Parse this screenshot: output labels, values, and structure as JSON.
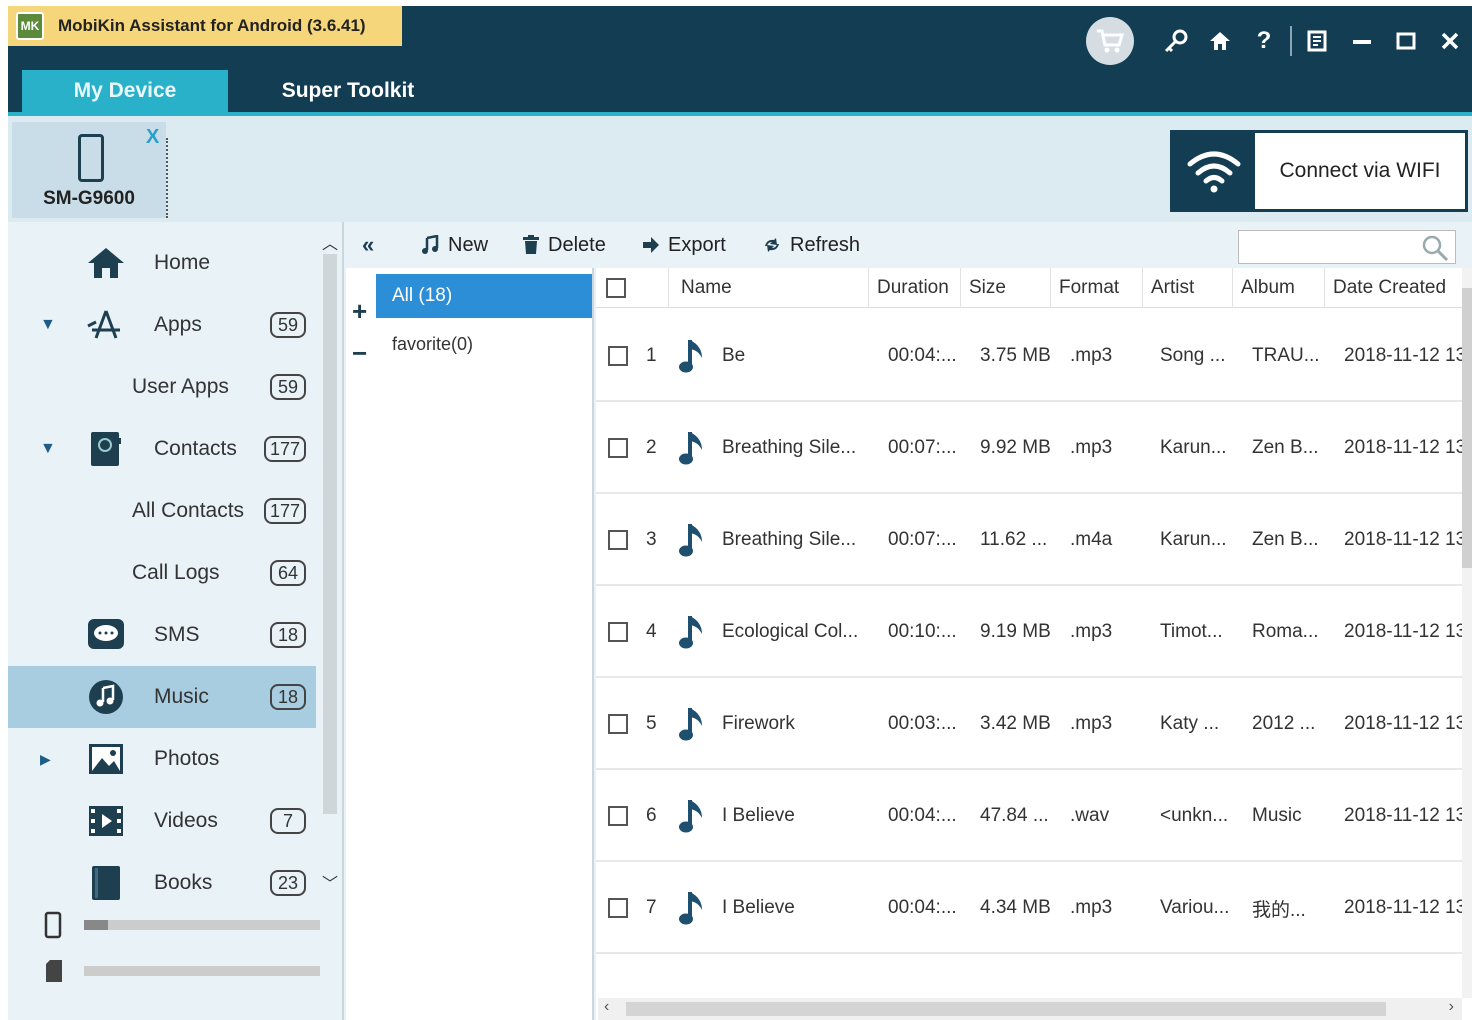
{
  "app": {
    "title": "MobiKin Assistant for Android (3.6.41)",
    "logo_text": "MK",
    "colors": {
      "titlebar": "#133d52",
      "accent": "#29b1c9",
      "title_chip": "#f5d67a",
      "selected_group": "#2b8ed6",
      "selected_nav": "#a8cde0"
    }
  },
  "window_icons": [
    "cart-icon",
    "key-icon",
    "home-icon",
    "help-icon",
    "feedback-icon",
    "minimize-icon",
    "maximize-icon",
    "close-icon"
  ],
  "tabs": [
    {
      "label": "My Device",
      "active": true
    },
    {
      "label": "Super Toolkit",
      "active": false
    }
  ],
  "device": {
    "name": "SM-G9600",
    "close": "X"
  },
  "wifi": {
    "label": "Connect via WIFI"
  },
  "sidebar": {
    "items": [
      {
        "label": "Home",
        "icon": "home-icon",
        "count": ""
      },
      {
        "label": "Apps",
        "icon": "apps-icon",
        "count": "59",
        "expanded": true
      },
      {
        "label": "User Apps",
        "icon": "",
        "count": "59",
        "sub": true
      },
      {
        "label": "Contacts",
        "icon": "contacts-icon",
        "count": "177",
        "expanded": true
      },
      {
        "label": "All Contacts",
        "icon": "",
        "count": "177",
        "sub": true
      },
      {
        "label": "Call Logs",
        "icon": "",
        "count": "64",
        "sub": true
      },
      {
        "label": "SMS",
        "icon": "sms-icon",
        "count": "18"
      },
      {
        "label": "Music",
        "icon": "music-icon",
        "count": "18",
        "selected": true
      },
      {
        "label": "Photos",
        "icon": "photos-icon",
        "count": "",
        "collapsed": true
      },
      {
        "label": "Videos",
        "icon": "videos-icon",
        "count": "7"
      },
      {
        "label": "Books",
        "icon": "books-icon",
        "count": "23"
      }
    ],
    "storage": [
      {
        "icon": "phone-storage-icon",
        "used_fraction": 0.1
      },
      {
        "icon": "sd-card-icon",
        "used_fraction": 0.0
      }
    ]
  },
  "toolbar": {
    "new": "New",
    "delete": "Delete",
    "export": "Export",
    "refresh": "Refresh",
    "search_value": ""
  },
  "groups": [
    {
      "label": "All (18)",
      "active": true
    },
    {
      "label": "favorite(0)",
      "active": false
    }
  ],
  "table": {
    "columns": [
      "Name",
      "Duration",
      "Size",
      "Format",
      "Artist",
      "Album",
      "Date Created"
    ],
    "rows": [
      {
        "n": "1",
        "name": "Be",
        "duration": "00:04:...",
        "size": "3.75 MB",
        "format": ".mp3",
        "artist": "Song ...",
        "album": "TRAU...",
        "date": "2018-11-12 13"
      },
      {
        "n": "2",
        "name": "Breathing Sile...",
        "duration": "00:07:...",
        "size": "9.92 MB",
        "format": ".mp3",
        "artist": "Karun...",
        "album": "Zen B...",
        "date": "2018-11-12 13"
      },
      {
        "n": "3",
        "name": "Breathing Sile...",
        "duration": "00:07:...",
        "size": "11.62 ...",
        "format": ".m4a",
        "artist": "Karun...",
        "album": "Zen B...",
        "date": "2018-11-12 13"
      },
      {
        "n": "4",
        "name": "Ecological Col...",
        "duration": "00:10:...",
        "size": "9.19 MB",
        "format": ".mp3",
        "artist": "Timot...",
        "album": "Roma...",
        "date": "2018-11-12 13"
      },
      {
        "n": "5",
        "name": "Firework",
        "duration": "00:03:...",
        "size": "3.42 MB",
        "format": ".mp3",
        "artist": "Katy ...",
        "album": "2012 ...",
        "date": "2018-11-12 13"
      },
      {
        "n": "6",
        "name": "I Believe",
        "duration": "00:04:...",
        "size": "47.84 ...",
        "format": ".wav",
        "artist": "<unkn...",
        "album": "Music",
        "date": "2018-11-12 13"
      },
      {
        "n": "7",
        "name": "I Believe",
        "duration": "00:04:...",
        "size": "4.34 MB",
        "format": ".mp3",
        "artist": "Variou...",
        "album": "我的...",
        "date": "2018-11-12 13"
      }
    ]
  }
}
